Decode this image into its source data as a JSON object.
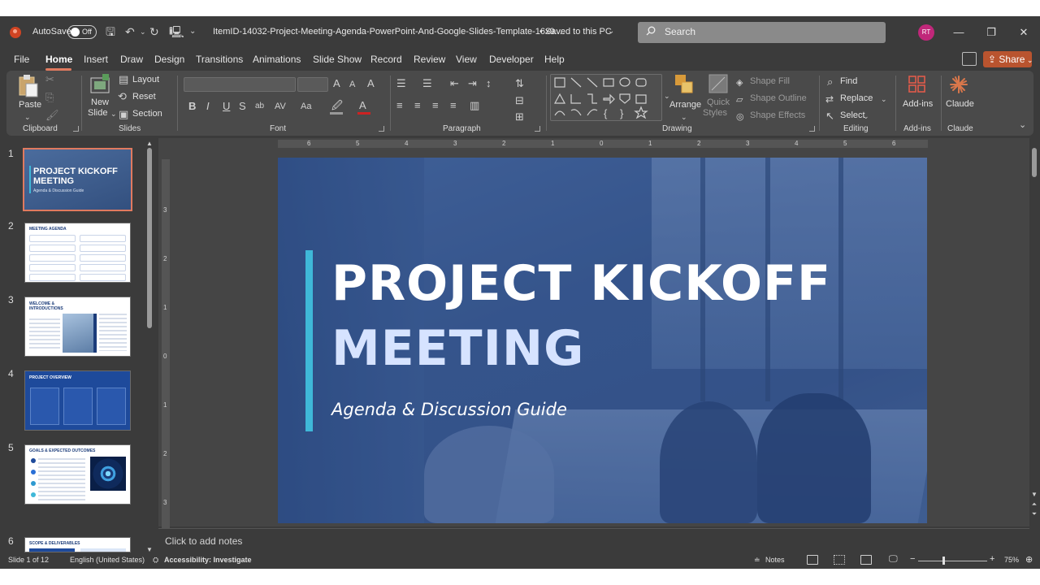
{
  "titlebar": {
    "autosave_label": "AutoSave",
    "autosave_state": "Off",
    "filename": "ItemID-14032-Project-Meeting-Agenda-PowerPoint-And-Google-Slides-Template-16x9....",
    "save_status": "• Saved to this PC",
    "search_placeholder": "Search",
    "avatar_initials": "RT"
  },
  "tabs": [
    "File",
    "Home",
    "Insert",
    "Draw",
    "Design",
    "Transitions",
    "Animations",
    "Slide Show",
    "Record",
    "Review",
    "View",
    "Developer",
    "Help"
  ],
  "active_tab": "Home",
  "share_label": "Share",
  "ribbon": {
    "clipboard": {
      "paste": "Paste",
      "group": "Clipboard"
    },
    "slides": {
      "new_slide_1": "New",
      "new_slide_2": "Slide",
      "layout": "Layout",
      "reset": "Reset",
      "section": "Section",
      "group": "Slides"
    },
    "font": {
      "group": "Font"
    },
    "paragraph": {
      "group": "Paragraph"
    },
    "drawing": {
      "arrange": "Arrange",
      "quick_styles_1": "Quick",
      "quick_styles_2": "Styles",
      "shape_fill": "Shape Fill",
      "shape_outline": "Shape Outline",
      "shape_effects": "Shape Effects",
      "group": "Drawing"
    },
    "editing": {
      "find": "Find",
      "replace": "Replace",
      "select": "Select",
      "group": "Editing"
    },
    "addins": {
      "label": "Add-ins",
      "group": "Add-ins"
    },
    "claude": {
      "label": "Claude",
      "group": "Claude"
    }
  },
  "thumbnails": [
    {
      "num": "1",
      "title": "PROJECT KICKOFF MEETING",
      "subtitle": "Agenda & Discussion Guide"
    },
    {
      "num": "2",
      "title": "MEETING AGENDA"
    },
    {
      "num": "3",
      "title": "WELCOME & INTRODUCTIONS"
    },
    {
      "num": "4",
      "title": "PROJECT OVERVIEW"
    },
    {
      "num": "5",
      "title": "GOALS & EXPECTED OUTCOMES"
    },
    {
      "num": "6",
      "title": "SCOPE & DELIVERABLES"
    }
  ],
  "slide": {
    "title_line1": "PROJECT KICKOFF",
    "title_line2": "MEETING",
    "subtitle": "Agenda & Discussion Guide"
  },
  "ruler_h": [
    "6",
    "5",
    "4",
    "3",
    "2",
    "1",
    "0",
    "1",
    "2",
    "3",
    "4",
    "5",
    "6"
  ],
  "ruler_v": [
    "3",
    "2",
    "1",
    "0",
    "1",
    "2",
    "3"
  ],
  "notes_placeholder": "Click to add notes",
  "status": {
    "slide_info": "Slide 1 of 12",
    "language": "English (United States)",
    "accessibility": "Accessibility: Investigate",
    "notes": "Notes",
    "zoom": "75%"
  },
  "colors": {
    "accent": "#e07a5f",
    "share": "#b9542f",
    "slide_bar": "#3fb8d8",
    "slide_bg": "#3b5a8c"
  }
}
